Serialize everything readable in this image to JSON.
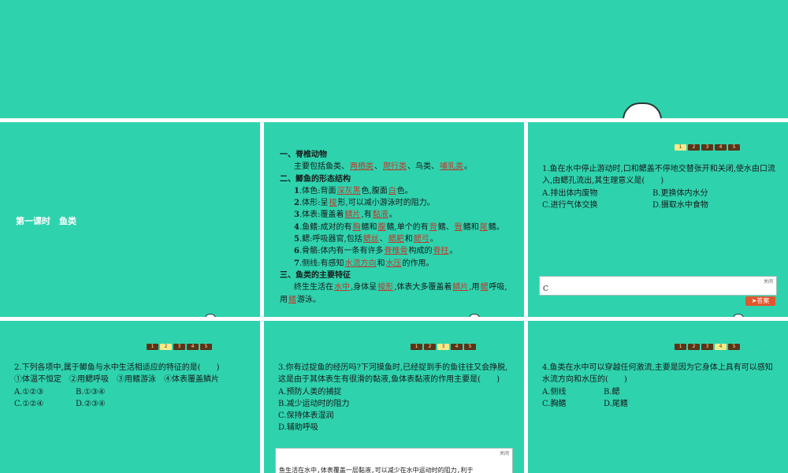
{
  "slide1": {
    "lesson_title": "第一课时　鱼类"
  },
  "slide2": {
    "lines": [
      {
        "segs": [
          {
            "t": "一、脊椎动物",
            "b": true
          }
        ]
      },
      {
        "indent": true,
        "segs": [
          {
            "t": "主要包括鱼类、"
          },
          {
            "t": "两栖类",
            "f": true
          },
          {
            "t": "、"
          },
          {
            "t": "爬行类",
            "f": true
          },
          {
            "t": "、鸟类、"
          },
          {
            "t": "哺乳类",
            "f": true
          },
          {
            "t": "。"
          }
        ]
      },
      {
        "segs": [
          {
            "t": "二、鲫鱼的形态结构",
            "b": true
          }
        ]
      },
      {
        "indent": true,
        "segs": [
          {
            "t": "1",
            "b": true
          },
          {
            "t": ".体色:背面"
          },
          {
            "t": "深灰黑",
            "f": true
          },
          {
            "t": "色,腹面"
          },
          {
            "t": "白",
            "f": true
          },
          {
            "t": "色。"
          }
        ]
      },
      {
        "indent": true,
        "segs": [
          {
            "t": "2",
            "b": true
          },
          {
            "t": ".体形:呈"
          },
          {
            "t": "梭",
            "f": true
          },
          {
            "t": "形,可以减小游泳时的阻力。"
          }
        ]
      },
      {
        "indent": true,
        "segs": [
          {
            "t": "3",
            "b": true
          },
          {
            "t": ".体表:覆盖着"
          },
          {
            "t": "鳞片",
            "f": true
          },
          {
            "t": ",有"
          },
          {
            "t": "黏液",
            "f": true
          },
          {
            "t": "。"
          }
        ]
      },
      {
        "indent": true,
        "segs": [
          {
            "t": "4",
            "b": true
          },
          {
            "t": ".鱼鳍:成对的有"
          },
          {
            "t": "胸",
            "f": true
          },
          {
            "t": "鳍和"
          },
          {
            "t": "腹",
            "f": true
          },
          {
            "t": "鳍,单个的有"
          },
          {
            "t": "背",
            "f": true
          },
          {
            "t": "鳍、"
          },
          {
            "t": "臀",
            "f": true
          },
          {
            "t": "鳍和"
          },
          {
            "t": "尾",
            "f": true
          },
          {
            "t": "鳍。"
          }
        ]
      },
      {
        "indent": true,
        "segs": [
          {
            "t": "5",
            "b": true
          },
          {
            "t": ".鳃:呼吸器官,包括"
          },
          {
            "t": "鳃丝",
            "f": true
          },
          {
            "t": "、"
          },
          {
            "t": "鳃耙",
            "f": true
          },
          {
            "t": "和"
          },
          {
            "t": "鳃弓",
            "f": true
          },
          {
            "t": "。"
          }
        ]
      },
      {
        "indent": true,
        "segs": [
          {
            "t": "6",
            "b": true
          },
          {
            "t": ".骨骼:体内有一条有许多"
          },
          {
            "t": "脊椎骨",
            "f": true
          },
          {
            "t": "构成的"
          },
          {
            "t": "脊柱",
            "f": true
          },
          {
            "t": "。"
          }
        ]
      },
      {
        "indent": true,
        "segs": [
          {
            "t": "7",
            "b": true
          },
          {
            "t": ".侧线:有感知"
          },
          {
            "t": "水流方向",
            "f": true
          },
          {
            "t": "和"
          },
          {
            "t": "水压",
            "f": true
          },
          {
            "t": "的作用。"
          }
        ]
      },
      {
        "segs": [
          {
            "t": "三、鱼类的主要特征",
            "b": true
          }
        ]
      },
      {
        "indent": true,
        "segs": [
          {
            "t": "终生生活在"
          },
          {
            "t": "水中",
            "f": true
          },
          {
            "t": ",身体呈"
          },
          {
            "t": "梭形",
            "f": true
          },
          {
            "t": ",体表大多覆盖着"
          },
          {
            "t": "鳞片",
            "f": true
          },
          {
            "t": ",用"
          },
          {
            "t": "鳃",
            "f": true
          },
          {
            "t": "呼吸,"
          }
        ]
      },
      {
        "segs": [
          {
            "t": "用"
          },
          {
            "t": "鳍",
            "f": true
          },
          {
            "t": "游泳。"
          }
        ]
      }
    ]
  },
  "pager": [
    "1",
    "2",
    "3",
    "4",
    "5"
  ],
  "slide3": {
    "question": "1.鱼在水中停止游动时,口和鳃盖不停地交替张开和关闭,使水由口流入,由鳃孔流出,其生理意义是(　　)",
    "options": [
      "A.排出体内废物",
      "B.更换体内水分",
      "C.进行气体交换",
      "D.摄取水中食物"
    ],
    "answer_close": "关闭",
    "answer": "C",
    "answer_button": "答案"
  },
  "slide4": {
    "question": "2.下列各项中,属于鲫鱼与水中生活相适应的特征的是(　　)",
    "items": "①体温不恒定　②用鳃呼吸　③用鳍游泳　④体表覆盖鳞片",
    "options": [
      "A.①②③",
      "B.①③④",
      "C.①②④",
      "D.②③④"
    ]
  },
  "slide5": {
    "question": "3.你有过捉鱼的经历吗?下河摸鱼时,已经捉到手的鱼往往又会挣脱,这是由于其体表生有很滑的黏液,鱼体表黏液的作用主要是(　　)",
    "options": [
      "A.预防人类的捕捉",
      "B.减少运动时的阻力",
      "C.保持体表湿润",
      "D.辅助呼吸"
    ],
    "answer_close": "关闭",
    "answer": "鱼生活在水中,体表覆盖一层黏液,可以减少在水中运动时的阻力,利于"
  },
  "slide6": {
    "question": "4.鱼类在水中可以穿越任何激流,主要是因为它身体上具有可以感知水流方向和水压的(　　)",
    "options": [
      "A.侧线",
      "B.鳃",
      "C.胸鳍",
      "D.尾鳍"
    ]
  },
  "colors": {
    "slide_bg": "#2ed3ae",
    "fill_text": "#c0392b",
    "pager_bg": "#5a3418",
    "pager_active": "#f6e98a",
    "answer_button": "#e2562e"
  }
}
